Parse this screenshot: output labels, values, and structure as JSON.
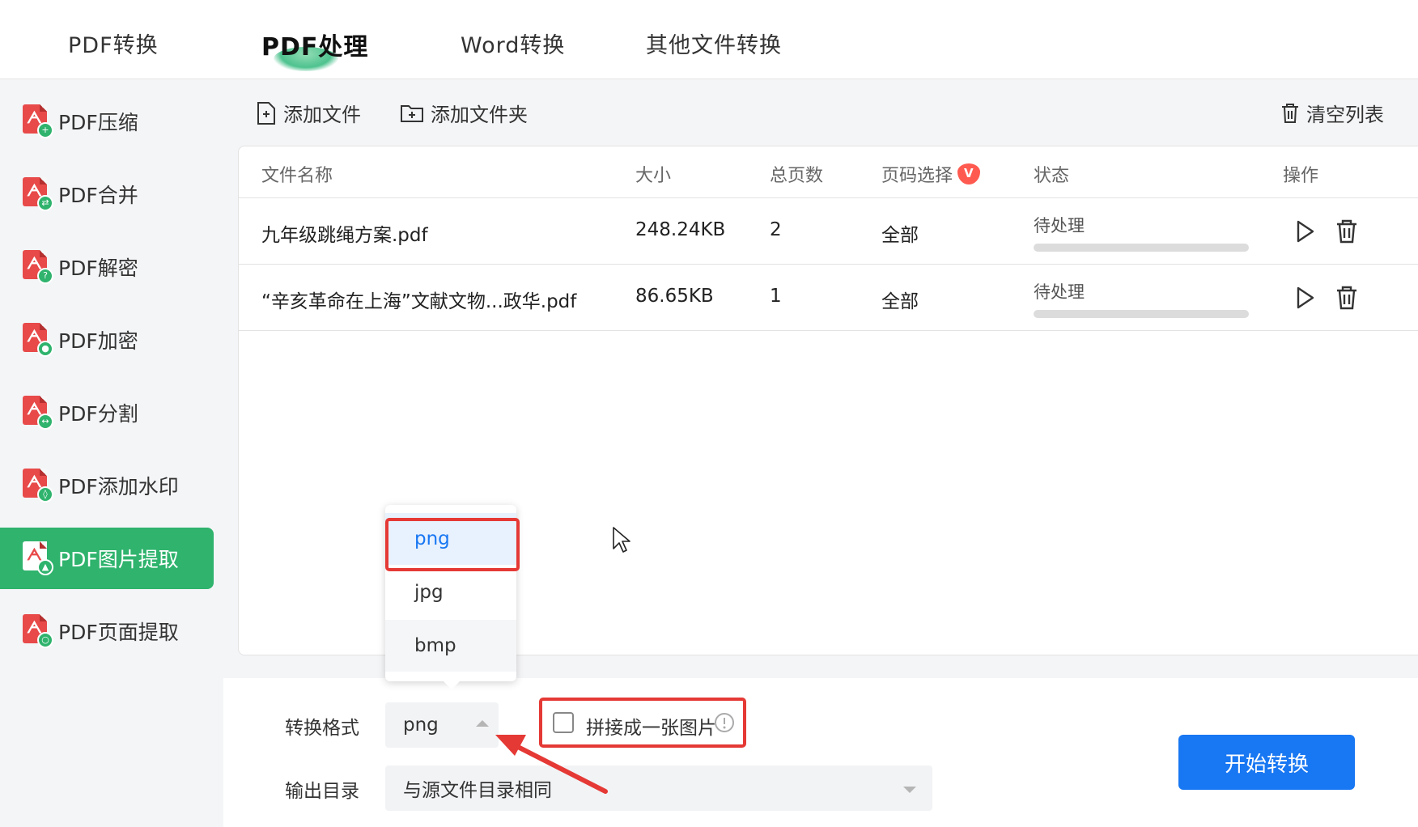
{
  "top_tabs": [
    {
      "label": "PDF转换"
    },
    {
      "label": "PDF处理"
    },
    {
      "label": "Word转换"
    },
    {
      "label": "其他文件转换"
    }
  ],
  "sidebar": {
    "items": [
      {
        "label": "PDF压缩",
        "icon": "pdf-compress-icon"
      },
      {
        "label": "PDF合并",
        "icon": "pdf-merge-icon"
      },
      {
        "label": "PDF解密",
        "icon": "pdf-decrypt-icon"
      },
      {
        "label": "PDF加密",
        "icon": "pdf-encrypt-icon"
      },
      {
        "label": "PDF分割",
        "icon": "pdf-split-icon"
      },
      {
        "label": "PDF添加水印",
        "icon": "pdf-watermark-icon"
      },
      {
        "label": "PDF图片提取",
        "icon": "pdf-image-extract-icon"
      },
      {
        "label": "PDF页面提取",
        "icon": "pdf-page-extract-icon"
      }
    ]
  },
  "toolbar": {
    "add_file": "添加文件",
    "add_folder": "添加文件夹",
    "clear_list": "清空列表"
  },
  "table": {
    "headers": {
      "name": "文件名称",
      "size": "大小",
      "pages": "总页数",
      "page_select": "页码选择",
      "status": "状态",
      "ops": "操作"
    },
    "rows": [
      {
        "name": "九年级跳绳方案.pdf",
        "size": "248.24KB",
        "pages": "2",
        "page_select": "全部",
        "status": "待处理",
        "progress": 0
      },
      {
        "name": "“辛亥革命在上海”文献文物...政华.pdf",
        "size": "86.65KB",
        "pages": "1",
        "page_select": "全部",
        "status": "待处理",
        "progress": 0
      }
    ]
  },
  "bottom": {
    "format_label": "转换格式",
    "format_value": "png",
    "merge_label": "拼接成一张图片",
    "merge_checked": false,
    "output_label": "输出目录",
    "output_value": "与源文件目录相同",
    "start_button": "开始转换"
  },
  "dropdown": {
    "options": [
      "png",
      "jpg",
      "bmp"
    ],
    "selected": "png"
  },
  "colors": {
    "accent_green": "#2fb36d",
    "primary_blue": "#1877f2",
    "annotation_red": "#e53935",
    "pdf_red": "#e84a4a"
  }
}
